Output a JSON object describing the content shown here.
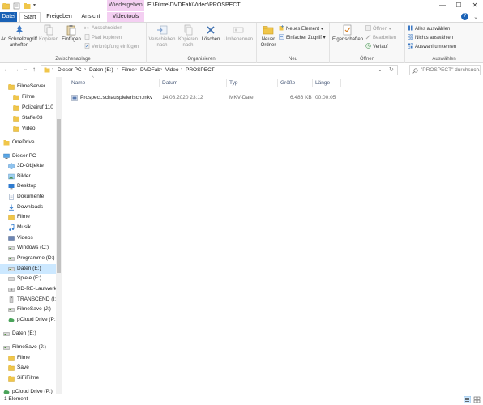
{
  "titlebar": {
    "context_group": "Wiedergeben",
    "window_title": "E:\\Filme\\DVDFab\\Video\\PROSPECT",
    "minimize": "—",
    "maximize": "☐",
    "close": "✕"
  },
  "tabs": {
    "file": "Datei",
    "start": "Start",
    "share": "Freigeben",
    "view": "Ansicht",
    "videotools": "Videotools",
    "expand": "⌄",
    "help": "?"
  },
  "ribbon": {
    "clipboard": {
      "label": "Zwischenablage",
      "pin": "An Schnellzugriff anheften",
      "copy": "Kopieren",
      "paste": "Einfügen",
      "cut": "Ausschneiden",
      "copy_path": "Pfad kopieren",
      "paste_shortcut": "Verknüpfung einfügen"
    },
    "organize": {
      "label": "Organisieren",
      "move_to": "Verschieben nach",
      "copy_to": "Kopieren nach",
      "delete": "Löschen",
      "rename": "Umbenennen"
    },
    "new": {
      "label": "Neu",
      "new_folder": "Neuer Ordner",
      "new_item": "Neues Element",
      "easy_access": "Einfacher Zugriff"
    },
    "open": {
      "label": "Öffnen",
      "properties": "Eigenschaften",
      "open": "Öffnen",
      "edit": "Bearbeiten",
      "history": "Verlauf"
    },
    "select": {
      "label": "Auswählen",
      "select_all": "Alles auswählen",
      "select_none": "Nichts auswählen",
      "invert": "Auswahl umkehren"
    }
  },
  "address": {
    "back": "←",
    "forward": "→",
    "recent": "⌄",
    "up": "↑",
    "crumbs": [
      "Dieser PC",
      "Daten (E:)",
      "Filme",
      "DVDFab",
      "Video",
      "PROSPECT"
    ],
    "dropdown": "⌄",
    "refresh": "↻",
    "search_placeholder": "\"PROSPECT\" durchsuch..."
  },
  "nav": {
    "items": [
      {
        "label": "FilmeServer",
        "icon": "folder-icon"
      },
      {
        "label": "Filme",
        "icon": "folder-icon"
      },
      {
        "label": "Polizeiruf 110",
        "icon": "folder-icon"
      },
      {
        "label": "Staffel03",
        "icon": "folder-icon"
      },
      {
        "label": "Video",
        "icon": "folder-icon"
      },
      {
        "label": "OneDrive",
        "icon": "cloud-folder-icon"
      },
      {
        "label": "Dieser PC",
        "icon": "computer-icon"
      },
      {
        "label": "3D-Objekte",
        "icon": "cube-icon"
      },
      {
        "label": "Bilder",
        "icon": "pictures-icon"
      },
      {
        "label": "Desktop",
        "icon": "desktop-icon"
      },
      {
        "label": "Dokumente",
        "icon": "documents-icon"
      },
      {
        "label": "Downloads",
        "icon": "download-icon"
      },
      {
        "label": "Filme",
        "icon": "folder-icon"
      },
      {
        "label": "Musik",
        "icon": "music-icon"
      },
      {
        "label": "Videos",
        "icon": "video-icon"
      },
      {
        "label": "Windows (C:)",
        "icon": "drive-icon"
      },
      {
        "label": "Programme (D:)",
        "icon": "drive-icon"
      },
      {
        "label": "Daten (E:)",
        "icon": "drive-icon"
      },
      {
        "label": "Spiele (F:)",
        "icon": "drive-icon"
      },
      {
        "label": "BD-RE-Laufwerk",
        "icon": "disc-drive-icon"
      },
      {
        "label": "TRANSCEND (I:)",
        "icon": "usb-drive-icon"
      },
      {
        "label": "FilmeSave (J:)",
        "icon": "drive-icon"
      },
      {
        "label": "pCloud Drive (P:",
        "icon": "cloud-drive-icon"
      },
      {
        "label": "Daten (E:)",
        "icon": "drive-icon"
      },
      {
        "label": "FilmeSave (J:)",
        "icon": "drive-icon"
      },
      {
        "label": "Filme",
        "icon": "folder-icon"
      },
      {
        "label": "Save",
        "icon": "folder-icon"
      },
      {
        "label": "SiFiFilme",
        "icon": "folder-icon"
      },
      {
        "label": "pCloud Drive (P:)",
        "icon": "cloud-drive-icon"
      }
    ],
    "selected_index": 17
  },
  "filelist": {
    "columns": {
      "name": "Name",
      "date": "Datum",
      "type": "Typ",
      "size": "Größe",
      "length": "Länge"
    },
    "sort_indicator": "^",
    "files": [
      {
        "name": "Prospect.schauspielerisch.mkv",
        "date": "14.08.2020 23:12",
        "type": "MKV-Datei",
        "size": "6.486 KB",
        "length": "00:00:05",
        "icon": "video-file-icon"
      }
    ]
  },
  "status": {
    "count": "1 Element"
  },
  "colors": {
    "accent": "#1a62b6",
    "context_tab": "#f4cff2",
    "selection": "#cce8ff",
    "folder": "#f0c64a"
  }
}
